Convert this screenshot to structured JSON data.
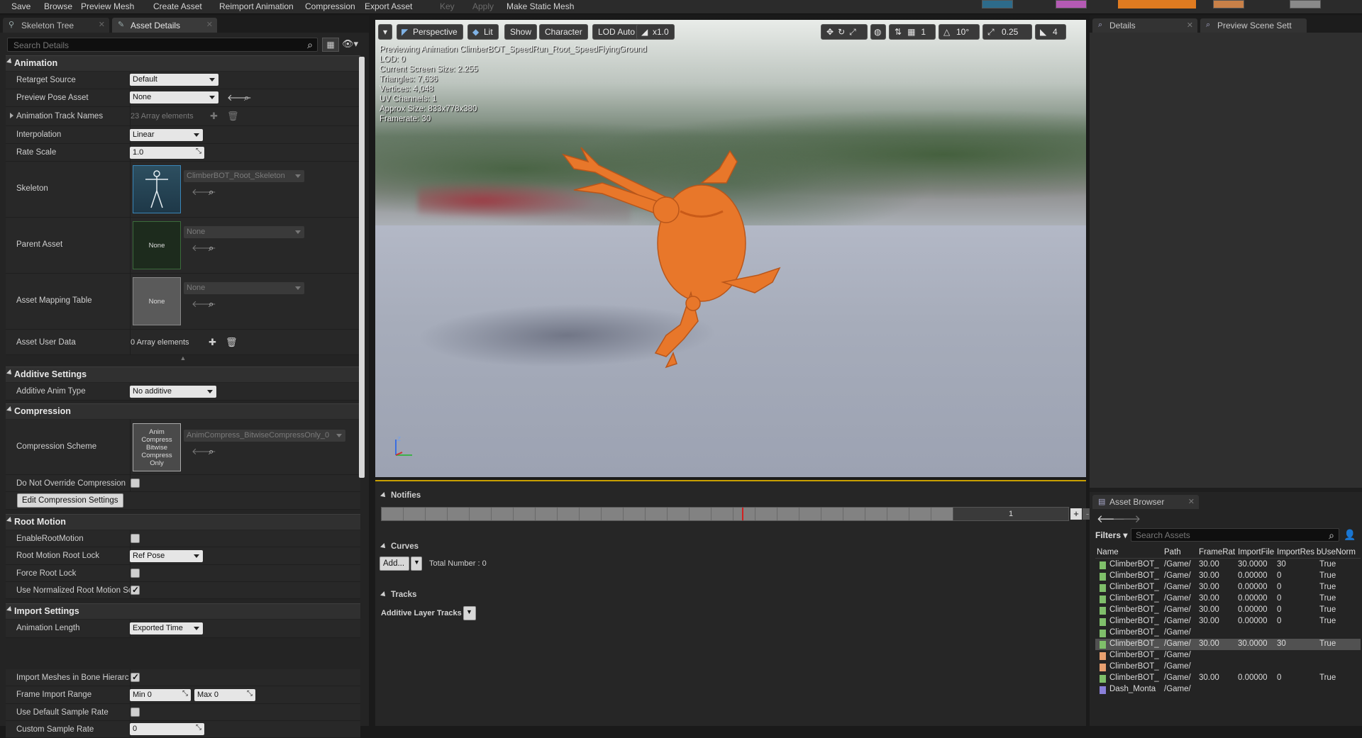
{
  "toolbar": {
    "items": [
      "Save",
      "Browse",
      "Preview Mesh",
      "Create Asset",
      "Reimport Animation",
      "Compression",
      "Export Asset",
      "Key",
      "Apply",
      "Make Static Mesh"
    ]
  },
  "left": {
    "tabs": [
      "Skeleton Tree",
      "Asset Details"
    ],
    "search_placeholder": "Search Details",
    "sections": {
      "animation": "Animation",
      "additive": "Additive Settings",
      "compression": "Compression",
      "root_motion": "Root Motion",
      "import": "Import Settings"
    },
    "animation": {
      "retarget_source_label": "Retarget Source",
      "retarget_source_value": "Default",
      "preview_pose_label": "Preview Pose Asset",
      "preview_pose_value": "None",
      "track_names_label": "Animation Track Names",
      "track_names_value": "23 Array elements",
      "interpolation_label": "Interpolation",
      "interpolation_value": "Linear",
      "rate_scale_label": "Rate Scale",
      "rate_scale_value": "1.0",
      "skeleton_label": "Skeleton",
      "skeleton_value": "ClimberBOT_Root_Skeleton",
      "parent_label": "Parent Asset",
      "parent_thumb": "None",
      "parent_value": "None",
      "mapping_label": "Asset Mapping Table",
      "mapping_thumb": "None",
      "mapping_value": "None",
      "user_data_label": "Asset User Data",
      "user_data_value": "0 Array elements"
    },
    "additive": {
      "type_label": "Additive Anim Type",
      "type_value": "No additive"
    },
    "compression": {
      "scheme_label": "Compression Scheme",
      "scheme_thumb": "Anim Compress Bitwise Compress Only",
      "scheme_value": "AnimCompress_BitwiseCompressOnly_0",
      "no_override_label": "Do Not Override Compression",
      "edit_button": "Edit Compression Settings"
    },
    "root_motion": {
      "enable_label": "EnableRootMotion",
      "lock_label": "Root Motion Root Lock",
      "lock_value": "Ref Pose",
      "force_label": "Force Root Lock",
      "normalized_label": "Use Normalized Root Motion Sc"
    },
    "import": {
      "length_label": "Animation Length",
      "length_value": "Exported Time",
      "meshes_label": "Import Meshes in Bone Hierarc",
      "range_label": "Frame Import Range",
      "range_min": "Min  0",
      "range_max": "Max  0",
      "default_rate_label": "Use Default Sample Rate",
      "custom_rate_label": "Custom Sample Rate",
      "custom_rate_value": "0"
    }
  },
  "viewport": {
    "buttons": {
      "perspective": "Perspective",
      "lit": "Lit",
      "show": "Show",
      "character": "Character",
      "lod": "LOD Auto",
      "speed": "x1.0",
      "angle": "10°",
      "scale": "0.25",
      "cam": "4"
    },
    "stats": [
      "Previewing Animation ClimberBOT_SpeedRun_Root_SpeedFlyingGround",
      "LOD: 0",
      "Current Screen Size: 2.255",
      "Triangles: 7,636",
      "Vertices: 4,048",
      "UV Channels: 1",
      "Approx Size: 833x778x380",
      "Framerate: 30"
    ]
  },
  "timeline": {
    "notifies": "Notifies",
    "track_number": "1",
    "curves": "Curves",
    "add_button": "Add...",
    "total_number": "Total Number : 0",
    "tracks": "Tracks",
    "additive_layer": "Additive Layer Tracks"
  },
  "right": {
    "tabs": [
      "Details",
      "Preview Scene Sett"
    ],
    "asset_browser_tab": "Asset Browser",
    "filters": "Filters",
    "search_placeholder": "Search Assets",
    "columns": [
      "Name",
      "Path",
      "FrameRat",
      "ImportFile",
      "ImportRes",
      "bUseNorm"
    ],
    "rows": [
      {
        "name": "ClimberBOT_",
        "path": "/Game/",
        "fr": "30.00",
        "imf": "30.0000",
        "imr": "30",
        "bn": "True",
        "kind": "anim"
      },
      {
        "name": "ClimberBOT_",
        "path": "/Game/",
        "fr": "30.00",
        "imf": "0.00000",
        "imr": "0",
        "bn": "True",
        "kind": "anim"
      },
      {
        "name": "ClimberBOT_",
        "path": "/Game/",
        "fr": "30.00",
        "imf": "0.00000",
        "imr": "0",
        "bn": "True",
        "kind": "anim"
      },
      {
        "name": "ClimberBOT_",
        "path": "/Game/",
        "fr": "30.00",
        "imf": "0.00000",
        "imr": "0",
        "bn": "True",
        "kind": "anim"
      },
      {
        "name": "ClimberBOT_",
        "path": "/Game/",
        "fr": "30.00",
        "imf": "0.00000",
        "imr": "0",
        "bn": "True",
        "kind": "anim"
      },
      {
        "name": "ClimberBOT_",
        "path": "/Game/",
        "fr": "30.00",
        "imf": "0.00000",
        "imr": "0",
        "bn": "True",
        "kind": "anim"
      },
      {
        "name": "ClimberBOT_",
        "path": "/Game/",
        "fr": "",
        "imf": "",
        "imr": "",
        "bn": "",
        "kind": "anim"
      },
      {
        "name": "ClimberBOT_",
        "path": "/Game/",
        "fr": "30.00",
        "imf": "30.0000",
        "imr": "30",
        "bn": "True",
        "kind": "anim",
        "selected": true
      },
      {
        "name": "ClimberBOT_",
        "path": "/Game/",
        "fr": "",
        "imf": "",
        "imr": "",
        "bn": "",
        "kind": "blend"
      },
      {
        "name": "ClimberBOT_",
        "path": "/Game/",
        "fr": "",
        "imf": "",
        "imr": "",
        "bn": "",
        "kind": "blend"
      },
      {
        "name": "ClimberBOT_",
        "path": "/Game/",
        "fr": "30.00",
        "imf": "0.00000",
        "imr": "0",
        "bn": "True",
        "kind": "anim"
      },
      {
        "name": "Dash_Monta",
        "path": "/Game/",
        "fr": "",
        "imf": "",
        "imr": "",
        "bn": "",
        "kind": "montage"
      }
    ]
  },
  "colors": {
    "accent_orange": "#e87a2a",
    "selection_blue": "#3a7bd5",
    "playhead_red": "#d02020",
    "anim_icon": "#7fbf6a",
    "blend_icon": "#e8a070",
    "montage_icon": "#8a7fd8"
  }
}
